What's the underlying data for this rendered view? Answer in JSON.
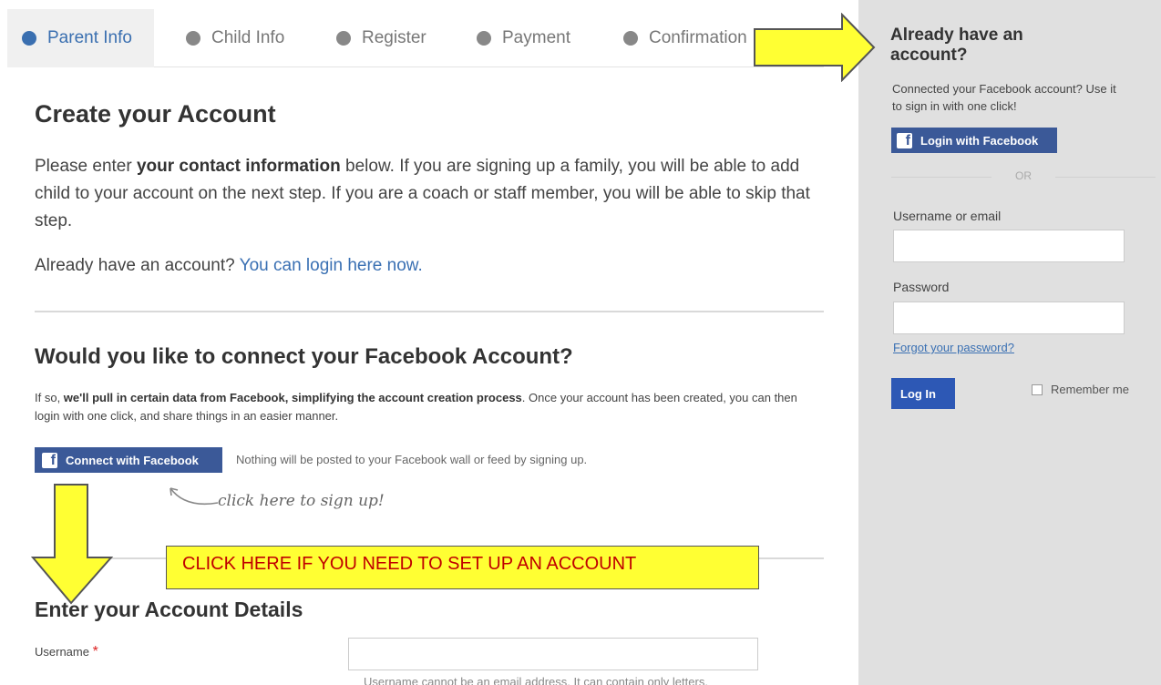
{
  "steps": [
    {
      "label": "Parent Info",
      "active": true
    },
    {
      "label": "Child Info",
      "active": false
    },
    {
      "label": "Register",
      "active": false
    },
    {
      "label": "Payment",
      "active": false
    },
    {
      "label": "Confirmation",
      "active": false
    }
  ],
  "main": {
    "title": "Create your Account",
    "intro_pre": "Please enter ",
    "intro_bold": "your contact information",
    "intro_post": " below. If you are signing up a family, you will be able to add child to your account on the next step. If you are a coach or staff member, you will be able to skip that step.",
    "already_text": "Already have an account? ",
    "already_link": "You can login here now.",
    "fb_heading": "Would you like to connect your Facebook Account?",
    "fb_pre": "If so, ",
    "fb_bold": "we'll pull in certain data from Facebook, simplifying the account creation process",
    "fb_post": ". Once your account has been created, you can then login with one click, and share things in an easier manner.",
    "connect_button": "Connect with Facebook",
    "nothing_posted": "Nothing will be posted to your Facebook wall or feed by signing up.",
    "hand_note": "click here to sign up!",
    "details_heading": "Enter your Account Details",
    "username_label": "Username",
    "required_mark": "*",
    "username_help": "Username cannot be an email address. It can contain only letters,"
  },
  "sidebar": {
    "title": "Already have an account?",
    "subtitle": "Connected your Facebook account? Use it to sign in with one click!",
    "fb_login_button": "Login with Facebook",
    "or": "OR",
    "username_label": "Username or email",
    "password_label": "Password",
    "forgot_link": "Forgot your password?",
    "login_button": "Log In",
    "remember_label": "Remember me"
  },
  "annotation": {
    "callout": "CLICK HERE IF YOU NEED TO SET UP AN ACCOUNT"
  },
  "colors": {
    "facebook": "#3b5998",
    "link": "#3a70b3",
    "annotation_yellow": "#ffff33",
    "annotation_text": "#c00000"
  }
}
